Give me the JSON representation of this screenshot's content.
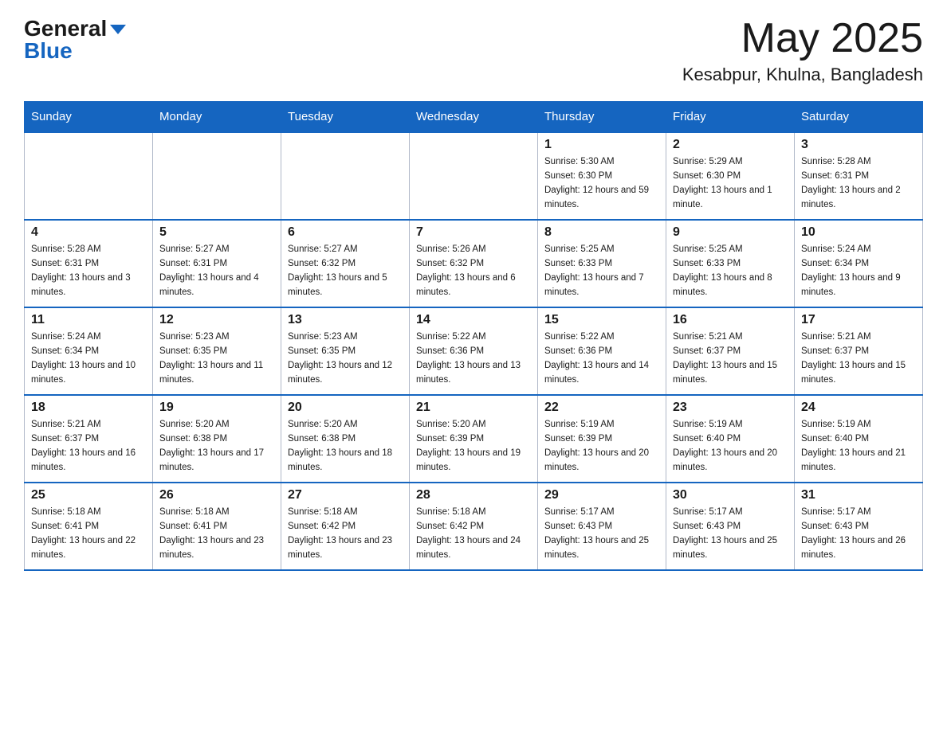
{
  "header": {
    "month_title": "May 2025",
    "location": "Kesabpur, Khulna, Bangladesh",
    "logo_general": "General",
    "logo_blue": "Blue"
  },
  "weekdays": [
    "Sunday",
    "Monday",
    "Tuesday",
    "Wednesday",
    "Thursday",
    "Friday",
    "Saturday"
  ],
  "weeks": [
    [
      {
        "day": "",
        "sunrise": "",
        "sunset": "",
        "daylight": ""
      },
      {
        "day": "",
        "sunrise": "",
        "sunset": "",
        "daylight": ""
      },
      {
        "day": "",
        "sunrise": "",
        "sunset": "",
        "daylight": ""
      },
      {
        "day": "",
        "sunrise": "",
        "sunset": "",
        "daylight": ""
      },
      {
        "day": "1",
        "sunrise": "Sunrise: 5:30 AM",
        "sunset": "Sunset: 6:30 PM",
        "daylight": "Daylight: 12 hours and 59 minutes."
      },
      {
        "day": "2",
        "sunrise": "Sunrise: 5:29 AM",
        "sunset": "Sunset: 6:30 PM",
        "daylight": "Daylight: 13 hours and 1 minute."
      },
      {
        "day": "3",
        "sunrise": "Sunrise: 5:28 AM",
        "sunset": "Sunset: 6:31 PM",
        "daylight": "Daylight: 13 hours and 2 minutes."
      }
    ],
    [
      {
        "day": "4",
        "sunrise": "Sunrise: 5:28 AM",
        "sunset": "Sunset: 6:31 PM",
        "daylight": "Daylight: 13 hours and 3 minutes."
      },
      {
        "day": "5",
        "sunrise": "Sunrise: 5:27 AM",
        "sunset": "Sunset: 6:31 PM",
        "daylight": "Daylight: 13 hours and 4 minutes."
      },
      {
        "day": "6",
        "sunrise": "Sunrise: 5:27 AM",
        "sunset": "Sunset: 6:32 PM",
        "daylight": "Daylight: 13 hours and 5 minutes."
      },
      {
        "day": "7",
        "sunrise": "Sunrise: 5:26 AM",
        "sunset": "Sunset: 6:32 PM",
        "daylight": "Daylight: 13 hours and 6 minutes."
      },
      {
        "day": "8",
        "sunrise": "Sunrise: 5:25 AM",
        "sunset": "Sunset: 6:33 PM",
        "daylight": "Daylight: 13 hours and 7 minutes."
      },
      {
        "day": "9",
        "sunrise": "Sunrise: 5:25 AM",
        "sunset": "Sunset: 6:33 PM",
        "daylight": "Daylight: 13 hours and 8 minutes."
      },
      {
        "day": "10",
        "sunrise": "Sunrise: 5:24 AM",
        "sunset": "Sunset: 6:34 PM",
        "daylight": "Daylight: 13 hours and 9 minutes."
      }
    ],
    [
      {
        "day": "11",
        "sunrise": "Sunrise: 5:24 AM",
        "sunset": "Sunset: 6:34 PM",
        "daylight": "Daylight: 13 hours and 10 minutes."
      },
      {
        "day": "12",
        "sunrise": "Sunrise: 5:23 AM",
        "sunset": "Sunset: 6:35 PM",
        "daylight": "Daylight: 13 hours and 11 minutes."
      },
      {
        "day": "13",
        "sunrise": "Sunrise: 5:23 AM",
        "sunset": "Sunset: 6:35 PM",
        "daylight": "Daylight: 13 hours and 12 minutes."
      },
      {
        "day": "14",
        "sunrise": "Sunrise: 5:22 AM",
        "sunset": "Sunset: 6:36 PM",
        "daylight": "Daylight: 13 hours and 13 minutes."
      },
      {
        "day": "15",
        "sunrise": "Sunrise: 5:22 AM",
        "sunset": "Sunset: 6:36 PM",
        "daylight": "Daylight: 13 hours and 14 minutes."
      },
      {
        "day": "16",
        "sunrise": "Sunrise: 5:21 AM",
        "sunset": "Sunset: 6:37 PM",
        "daylight": "Daylight: 13 hours and 15 minutes."
      },
      {
        "day": "17",
        "sunrise": "Sunrise: 5:21 AM",
        "sunset": "Sunset: 6:37 PM",
        "daylight": "Daylight: 13 hours and 15 minutes."
      }
    ],
    [
      {
        "day": "18",
        "sunrise": "Sunrise: 5:21 AM",
        "sunset": "Sunset: 6:37 PM",
        "daylight": "Daylight: 13 hours and 16 minutes."
      },
      {
        "day": "19",
        "sunrise": "Sunrise: 5:20 AM",
        "sunset": "Sunset: 6:38 PM",
        "daylight": "Daylight: 13 hours and 17 minutes."
      },
      {
        "day": "20",
        "sunrise": "Sunrise: 5:20 AM",
        "sunset": "Sunset: 6:38 PM",
        "daylight": "Daylight: 13 hours and 18 minutes."
      },
      {
        "day": "21",
        "sunrise": "Sunrise: 5:20 AM",
        "sunset": "Sunset: 6:39 PM",
        "daylight": "Daylight: 13 hours and 19 minutes."
      },
      {
        "day": "22",
        "sunrise": "Sunrise: 5:19 AM",
        "sunset": "Sunset: 6:39 PM",
        "daylight": "Daylight: 13 hours and 20 minutes."
      },
      {
        "day": "23",
        "sunrise": "Sunrise: 5:19 AM",
        "sunset": "Sunset: 6:40 PM",
        "daylight": "Daylight: 13 hours and 20 minutes."
      },
      {
        "day": "24",
        "sunrise": "Sunrise: 5:19 AM",
        "sunset": "Sunset: 6:40 PM",
        "daylight": "Daylight: 13 hours and 21 minutes."
      }
    ],
    [
      {
        "day": "25",
        "sunrise": "Sunrise: 5:18 AM",
        "sunset": "Sunset: 6:41 PM",
        "daylight": "Daylight: 13 hours and 22 minutes."
      },
      {
        "day": "26",
        "sunrise": "Sunrise: 5:18 AM",
        "sunset": "Sunset: 6:41 PM",
        "daylight": "Daylight: 13 hours and 23 minutes."
      },
      {
        "day": "27",
        "sunrise": "Sunrise: 5:18 AM",
        "sunset": "Sunset: 6:42 PM",
        "daylight": "Daylight: 13 hours and 23 minutes."
      },
      {
        "day": "28",
        "sunrise": "Sunrise: 5:18 AM",
        "sunset": "Sunset: 6:42 PM",
        "daylight": "Daylight: 13 hours and 24 minutes."
      },
      {
        "day": "29",
        "sunrise": "Sunrise: 5:17 AM",
        "sunset": "Sunset: 6:43 PM",
        "daylight": "Daylight: 13 hours and 25 minutes."
      },
      {
        "day": "30",
        "sunrise": "Sunrise: 5:17 AM",
        "sunset": "Sunset: 6:43 PM",
        "daylight": "Daylight: 13 hours and 25 minutes."
      },
      {
        "day": "31",
        "sunrise": "Sunrise: 5:17 AM",
        "sunset": "Sunset: 6:43 PM",
        "daylight": "Daylight: 13 hours and 26 minutes."
      }
    ]
  ]
}
